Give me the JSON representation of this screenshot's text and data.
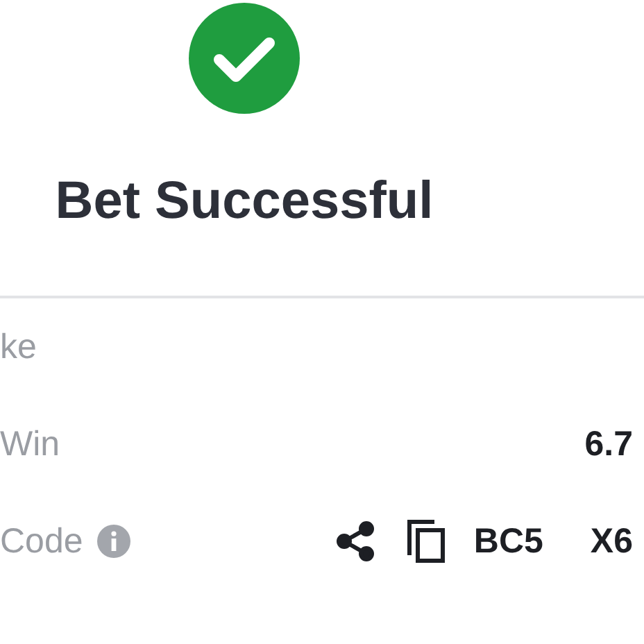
{
  "status": {
    "kind": "success",
    "title": "Bet Successful"
  },
  "rows": [
    {
      "kind": "plain",
      "label": "ke"
    },
    {
      "kind": "value",
      "label": "Win",
      "value": "6.7"
    },
    {
      "kind": "code",
      "label": "Code",
      "info": true,
      "code_parts": [
        "BC5",
        "X6"
      ]
    }
  ]
}
